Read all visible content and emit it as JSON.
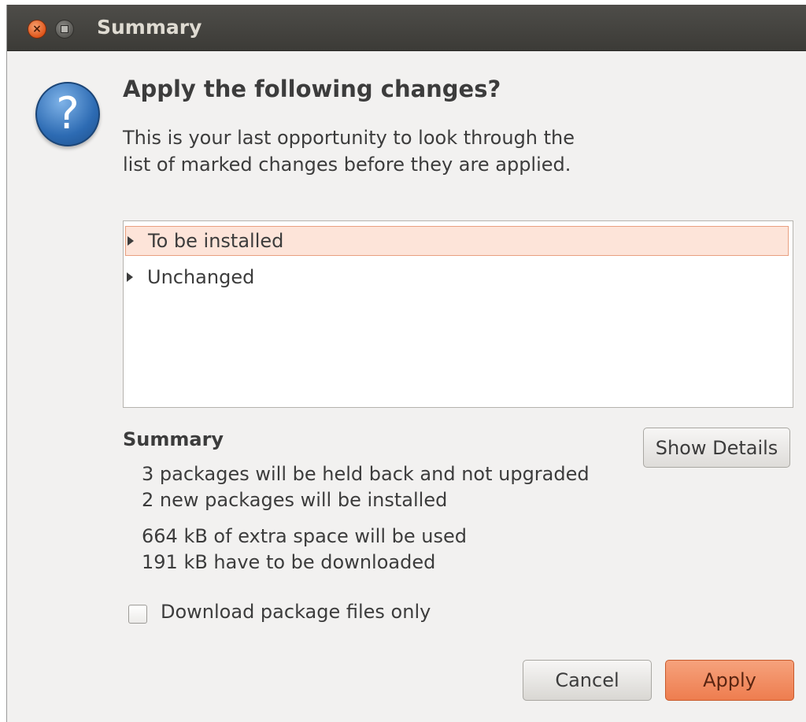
{
  "window": {
    "title": "Summary",
    "close_glyph": "×",
    "close_icon": "close-icon",
    "minimize_icon": "minimize-icon"
  },
  "dialog": {
    "icon": "question-icon",
    "icon_glyph": "?",
    "heading": "Apply the following changes?",
    "description": "This is your last opportunity to look through the list of marked changes before they are applied."
  },
  "tree": {
    "items": [
      {
        "label": "To be installed",
        "selected": true
      },
      {
        "label": "Unchanged",
        "selected": false
      }
    ]
  },
  "summary": {
    "label": "Summary",
    "show_details_label": "Show Details",
    "lines": [
      "3 packages will be held back and not upgraded",
      "2 new packages will be installed",
      "664 kB of extra space will be used",
      "191 kB have to be downloaded"
    ]
  },
  "options": {
    "download_only_label": "Download package files only",
    "download_only_checked": false
  },
  "buttons": {
    "cancel_label": "Cancel",
    "apply_label": "Apply"
  },
  "colors": {
    "accent": "#ee7d4f",
    "selection": "#fde4d9",
    "titlebar": "#3c3b37"
  }
}
